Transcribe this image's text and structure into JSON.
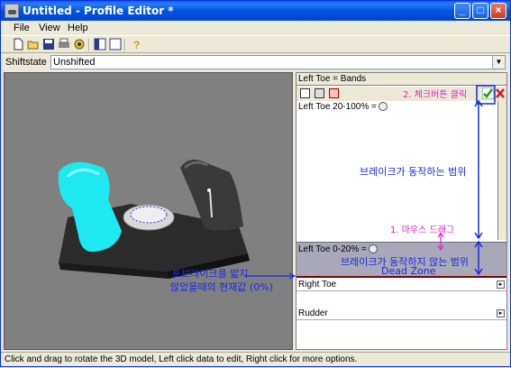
{
  "window": {
    "title": "Untitled - Profile Editor *"
  },
  "menu": [
    {
      "label": "File"
    },
    {
      "label": "View"
    },
    {
      "label": "Help"
    }
  ],
  "shiftstate": {
    "label": "Shiftstate",
    "value": "Unshifted"
  },
  "panel": {
    "header": "Left Toe = Bands",
    "band_upper": "Left Toe 20-100% =",
    "band_lower": "Left Toe 0-20% =",
    "sections": [
      {
        "label": "Right Toe"
      },
      {
        "label": "Rudder"
      }
    ]
  },
  "annotations": {
    "step2": "2. 체크버튼 클릭",
    "active_range": "브레이크가 동작하는 범위",
    "step1": "1. 마우스 드래그",
    "inactive_range": "브레이크가 동작하지 않는 범위",
    "dead_zone": "Dead Zone",
    "current_value_line1": "토브레이크를 밟지",
    "current_value_line2": "않았을때의 현재값 (0%)"
  },
  "status": {
    "text": "Click and drag to rotate the 3D model, Left click data to edit, Right click for more options."
  },
  "colors": {
    "annot_blue": "#1a2be0",
    "annot_pink": "#e020c8",
    "deadzone": "#a8a8b8",
    "pedal_cyan": "#1ee8f0"
  },
  "icons": [
    "app-icon",
    "new-file-icon",
    "open-folder-icon",
    "save-icon",
    "print-icon",
    "settings-icon",
    "layout-split-icon",
    "layout-single-icon",
    "help-icon",
    "check-icon",
    "close-x-icon"
  ]
}
